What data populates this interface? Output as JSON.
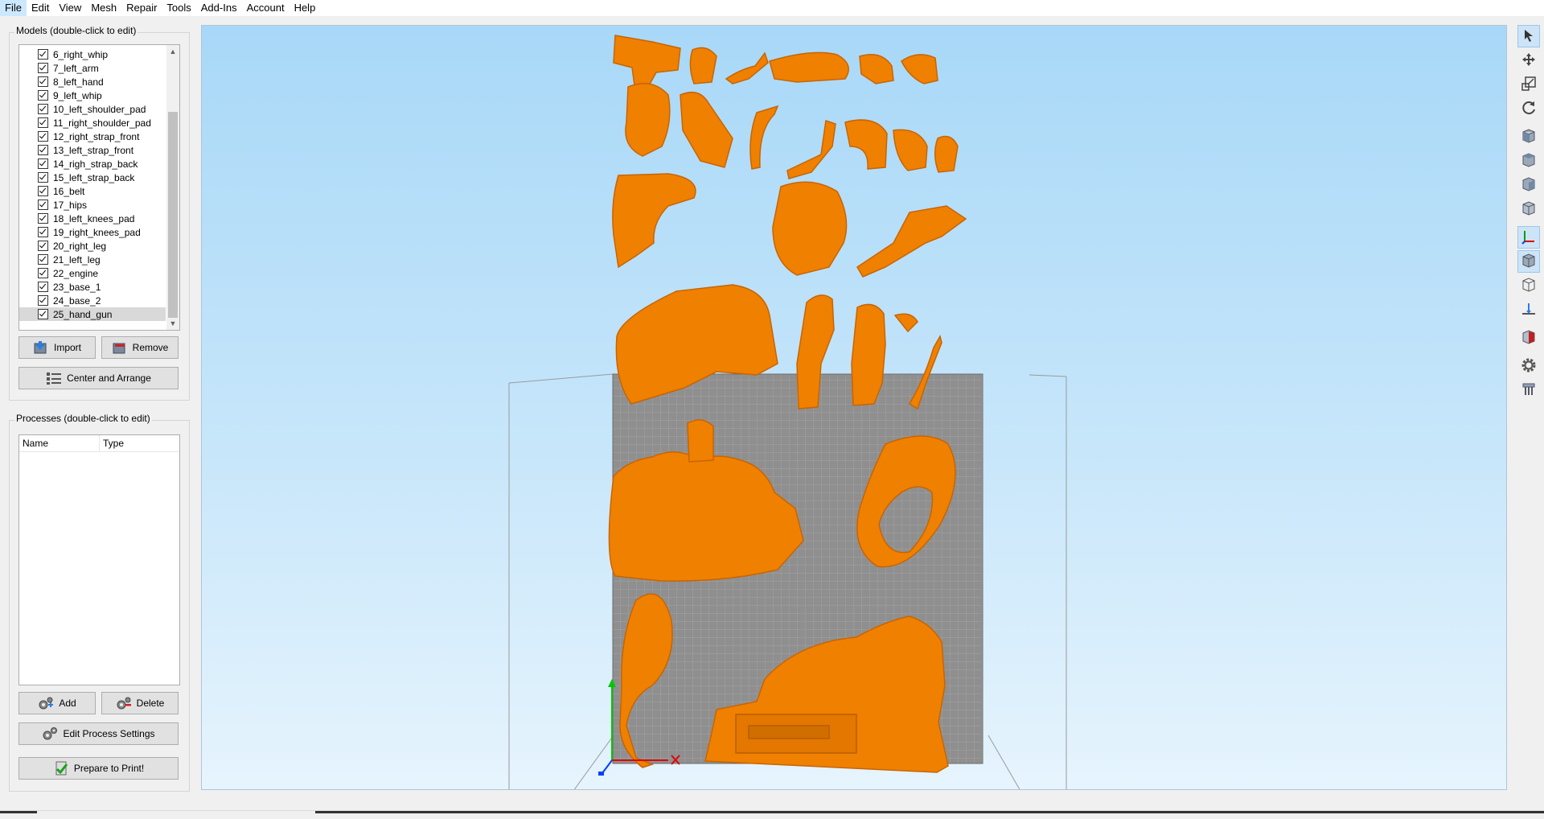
{
  "menu": [
    "File",
    "Edit",
    "View",
    "Mesh",
    "Repair",
    "Tools",
    "Add-Ins",
    "Account",
    "Help"
  ],
  "models_panel": {
    "title": "Models (double-click to edit)",
    "items": [
      "6_right_whip",
      "7_left_arm",
      "8_left_hand",
      "9_left_whip",
      "10_left_shoulder_pad",
      "11_right_shoulder_pad",
      "12_right_strap_front",
      "13_left_strap_front",
      "14_righ_strap_back",
      "15_left_strap_back",
      "16_belt",
      "17_hips",
      "18_left_knees_pad",
      "19_right_knees_pad",
      "20_right_leg",
      "21_left_leg",
      "22_engine",
      "23_base_1",
      "24_base_2",
      "25_hand_gun"
    ],
    "selected": "25_hand_gun",
    "import_label": "Import",
    "remove_label": "Remove",
    "center_label": "Center and Arrange"
  },
  "processes_panel": {
    "title": "Processes (double-click to edit)",
    "columns": [
      "Name",
      "Type"
    ],
    "add_label": "Add",
    "delete_label": "Delete",
    "edit_label": "Edit Process Settings",
    "prepare_label": "Prepare to Print!"
  },
  "viewport": {
    "model_color": "#f08000",
    "bed_color": "#8f8f8f",
    "sky_top": "#a8d8f8"
  },
  "toolbar_icons": [
    "select-arrow-icon",
    "move-icon",
    "scale-icon",
    "rotate-icon",
    "view-front-cube-icon",
    "view-top-cube-icon",
    "view-side-cube-icon",
    "view-iso-cube-icon",
    "axes-icon",
    "solid-cube-icon",
    "wireframe-cube-icon",
    "ground-plane-icon",
    "cross-section-icon",
    "settings-gear-icon",
    "supports-icon"
  ]
}
